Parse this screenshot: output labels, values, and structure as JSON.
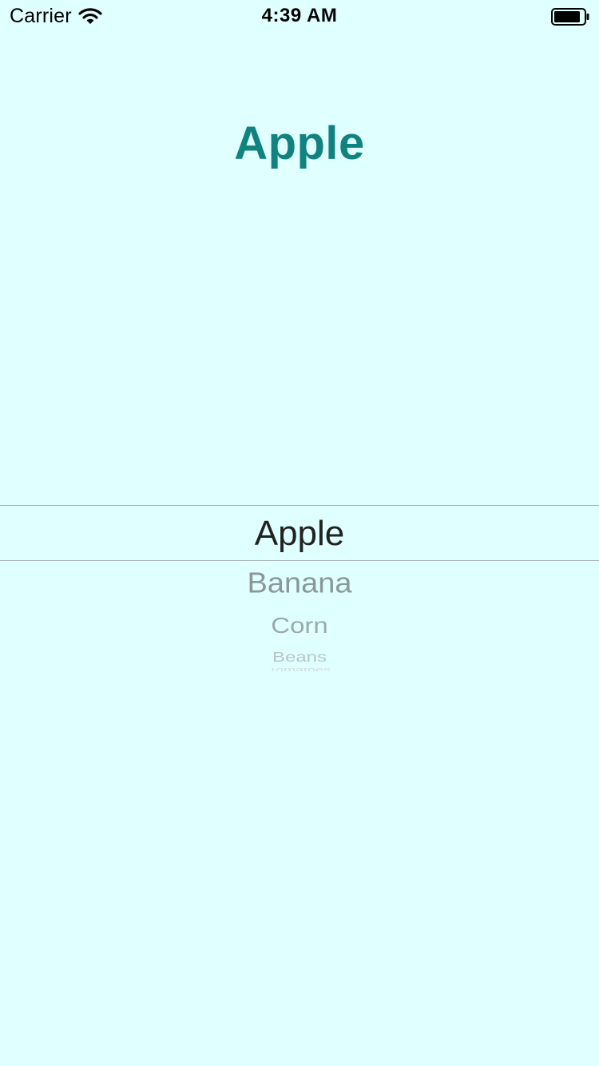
{
  "status_bar": {
    "carrier": "Carrier",
    "time": "4:39 AM"
  },
  "title": "Apple",
  "picker": {
    "selected": "Apple",
    "items_below": [
      "Banana",
      "Corn",
      "Beans",
      "Tomatoes"
    ]
  },
  "colors": {
    "background": "#E0FFFF",
    "title": "#10827F",
    "selected_text": "#222222",
    "divider": "#A5B3B3"
  },
  "icons": {
    "wifi": "wifi-icon",
    "battery": "battery-icon"
  }
}
